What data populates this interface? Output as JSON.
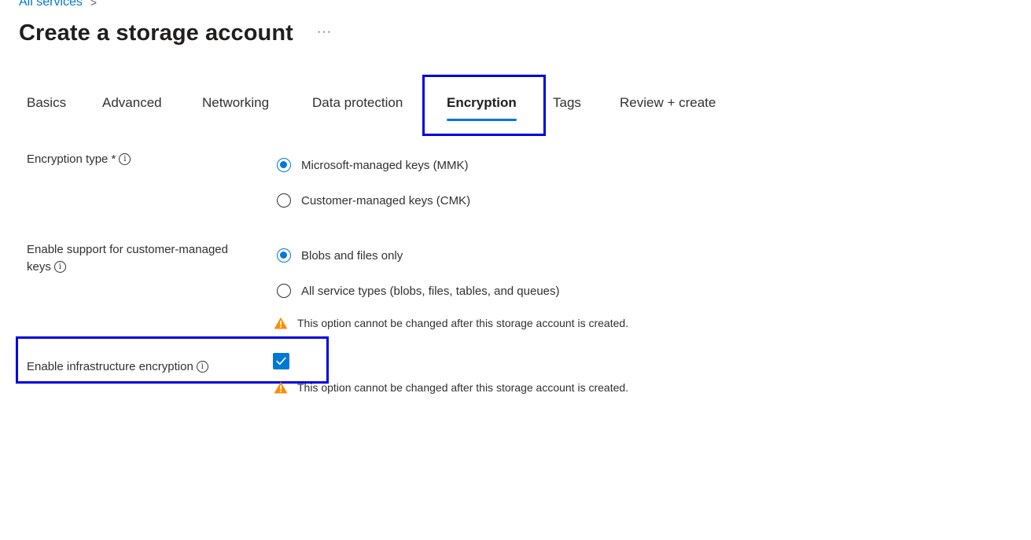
{
  "breadcrumb": {
    "item": "All services",
    "separator": ">"
  },
  "header": {
    "title": "Create a storage account",
    "more_label": "···"
  },
  "tabs": [
    {
      "label": "Basics"
    },
    {
      "label": "Advanced"
    },
    {
      "label": "Networking"
    },
    {
      "label": "Data protection"
    },
    {
      "label": "Encryption",
      "active": true
    },
    {
      "label": "Tags"
    },
    {
      "label": "Review + create"
    }
  ],
  "form": {
    "encryption_type": {
      "label": "Encryption type *",
      "options": [
        {
          "label": "Microsoft-managed keys (MMK)",
          "selected": true
        },
        {
          "label": "Customer-managed keys (CMK)",
          "selected": false
        }
      ]
    },
    "cmk_support": {
      "label_line1": "Enable support for customer-managed",
      "label_line2": "keys",
      "options": [
        {
          "label": "Blobs and files only",
          "selected": true
        },
        {
          "label": "All service types (blobs, files, tables, and queues)",
          "selected": false
        }
      ],
      "warning": "This option cannot be changed after this storage account is created."
    },
    "infrastructure_encryption": {
      "label": "Enable infrastructure encryption",
      "checked": true,
      "warning": "This option cannot be changed after this storage account is created."
    }
  },
  "icons": {
    "info": "info-icon",
    "warning": "warning-icon",
    "check": "check-icon",
    "chevron": "chevron-right-icon"
  },
  "colors": {
    "accent": "#0078d4",
    "highlight": "#0000e0",
    "warning": "#ff8c00"
  }
}
